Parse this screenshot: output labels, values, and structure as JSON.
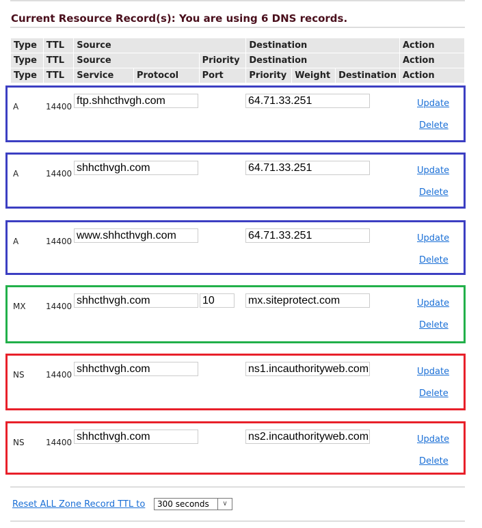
{
  "title": "Current Resource Record(s): You are using 6 DNS records.",
  "header_rows": [
    [
      "Type",
      "TTL",
      "Source",
      "Destination",
      "Action"
    ],
    [
      "Type",
      "TTL",
      "Source",
      "Priority",
      "Destination",
      "Action"
    ],
    [
      "Type",
      "TTL",
      "Service",
      "Protocol",
      "Port",
      "Priority",
      "Weight",
      "Destination",
      "Action"
    ]
  ],
  "records": [
    {
      "type": "A",
      "ttl": "14400",
      "source": "ftp.shhcthvgh.com",
      "priority": null,
      "destination": "64.71.33.251",
      "color": "#3c3fc2"
    },
    {
      "type": "A",
      "ttl": "14400",
      "source": "shhcthvgh.com",
      "priority": null,
      "destination": "64.71.33.251",
      "color": "#3c3fc2"
    },
    {
      "type": "A",
      "ttl": "14400",
      "source": "www.shhcthvgh.com",
      "priority": null,
      "destination": "64.71.33.251",
      "color": "#3c3fc2"
    },
    {
      "type": "MX",
      "ttl": "14400",
      "source": "shhcthvgh.com",
      "priority": "10",
      "destination": "mx.siteprotect.com",
      "color": "#22b04a"
    },
    {
      "type": "NS",
      "ttl": "14400",
      "source": "shhcthvgh.com",
      "priority": null,
      "destination": "ns1.incauthorityweb.com",
      "color": "#e8202a"
    },
    {
      "type": "NS",
      "ttl": "14400",
      "source": "shhcthvgh.com",
      "priority": null,
      "destination": "ns2.incauthorityweb.com",
      "color": "#e8202a"
    }
  ],
  "actions": {
    "update": "Update",
    "delete": "Delete"
  },
  "reset": {
    "label": "Reset ALL Zone Record TTL to",
    "selected": "300 seconds"
  }
}
